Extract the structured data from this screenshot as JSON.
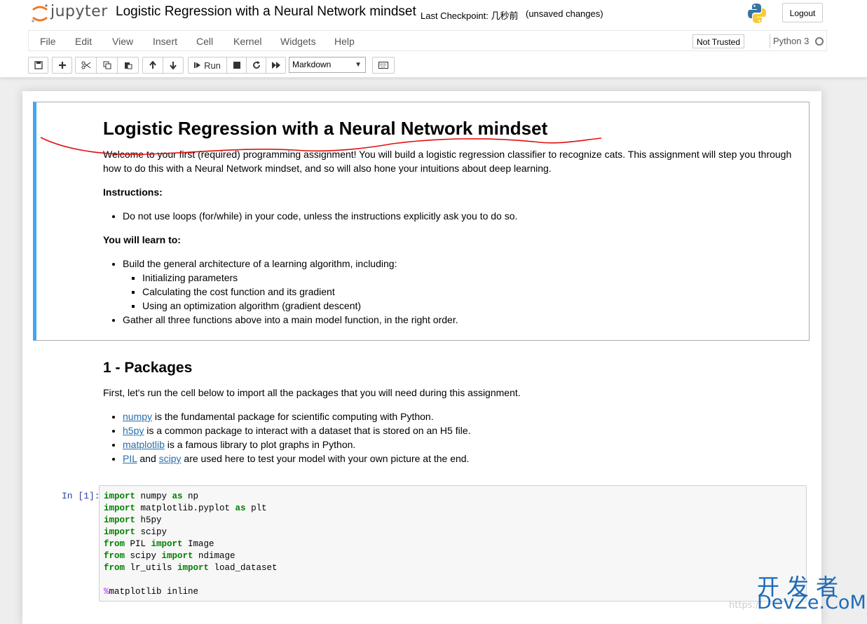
{
  "header": {
    "logo_text": "jupyter",
    "notebook_name": "Logistic Regression with a Neural Network mindset",
    "checkpoint_text": "Last Checkpoint: 几秒前",
    "autosave_status": "(unsaved changes)",
    "logout_label": "Logout"
  },
  "menu": {
    "items": [
      "File",
      "Edit",
      "View",
      "Insert",
      "Cell",
      "Kernel",
      "Widgets",
      "Help"
    ],
    "trust_label": "Not Trusted",
    "kernel_name": "Python 3"
  },
  "toolbar": {
    "run_label": "Run",
    "cell_type": "Markdown"
  },
  "cells": {
    "intro": {
      "title": "Logistic Regression with a Neural Network mindset",
      "welcome": "Welcome to your first (required) programming assignment! You will build a logistic regression classifier to recognize cats. This assignment will step you through how to do this with a Neural Network mindset, and so will also hone your intuitions about deep learning.",
      "instructions_heading": "Instructions:",
      "instructions": [
        "Do not use loops (for/while) in your code, unless the instructions explicitly ask you to do so."
      ],
      "learn_heading": "You will learn to:",
      "learn_main": "Build the general architecture of a learning algorithm, including:",
      "learn_sub": [
        "Initializing parameters",
        "Calculating the cost function and its gradient",
        "Using an optimization algorithm (gradient descent)"
      ],
      "learn_last": "Gather all three functions above into a main model function, in the right order."
    },
    "packages": {
      "title": "1 - Packages",
      "intro": "First, let's run the cell below to import all the packages that you will need during this assignment.",
      "items": [
        {
          "link": "numpy",
          "text": " is the fundamental package for scientific computing with Python."
        },
        {
          "link": "h5py",
          "text": " is a common package to interact with a dataset that is stored on an H5 file."
        },
        {
          "link": "matplotlib",
          "text": " is a famous library to plot graphs in Python."
        },
        {
          "link": "PIL",
          "mid": " and ",
          "link2": "scipy",
          "text": " are used here to test your model with your own picture at the end."
        }
      ]
    },
    "code": {
      "prompt": "In [1]:",
      "lines": [
        {
          "kw": "import",
          "a": " numpy ",
          "kw2": "as",
          "b": " np"
        },
        {
          "kw": "import",
          "a": " matplotlib.pyplot ",
          "kw2": "as",
          "b": " plt"
        },
        {
          "kw": "import",
          "a": " h5py",
          "kw2": "",
          "b": ""
        },
        {
          "kw": "import",
          "a": " scipy",
          "kw2": "",
          "b": ""
        },
        {
          "kw": "from",
          "a": " PIL ",
          "kw2": "import",
          "b": " Image"
        },
        {
          "kw": "from",
          "a": " scipy ",
          "kw2": "import",
          "b": " ndimage"
        },
        {
          "kw": "from",
          "a": " lr_utils ",
          "kw2": "import",
          "b": " load_dataset"
        }
      ],
      "magic_symbol": "%",
      "magic_text": "matplotlib inline"
    }
  },
  "watermark": {
    "cn": "开发者",
    "en": "DevZe.CoM",
    "url": "https://"
  },
  "colors": {
    "selected_cell_border": "#42a5f5",
    "link": "#296eaa",
    "keyword": "#008000",
    "magic": "#aa22ff",
    "annotation": "#e01010"
  }
}
